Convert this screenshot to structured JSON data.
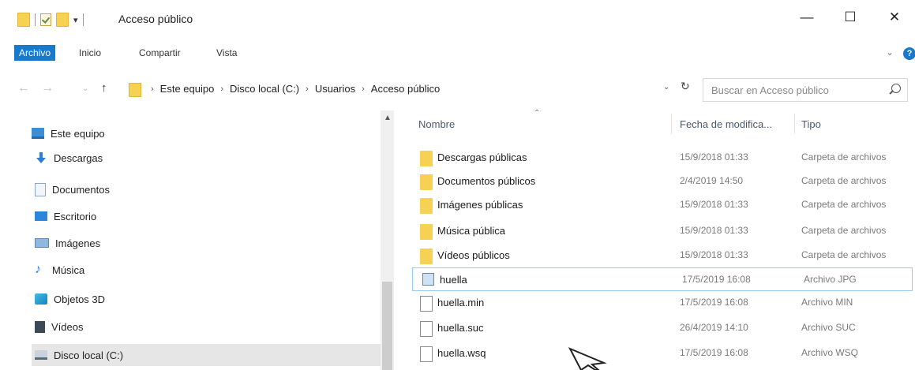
{
  "window": {
    "title": "Acceso público",
    "controls": {
      "minimize": "—",
      "maximize": "☐",
      "close": "✕"
    }
  },
  "ribbon": {
    "tabs": [
      "Archivo",
      "Inicio",
      "Compartir",
      "Vista"
    ],
    "expand": "⌄",
    "help": "?"
  },
  "address_bar": {
    "nav": {
      "back": "←",
      "forward": "→",
      "recent": "⌄",
      "up": "↑"
    },
    "breadcrumb": [
      "Este equipo",
      "Disco local (C:)",
      "Usuarios",
      "Acceso público"
    ],
    "chevron": "›",
    "dropdown": "⌄",
    "refresh": "↻"
  },
  "search": {
    "placeholder": "Buscar en Acceso público"
  },
  "nav_pane": {
    "items": [
      {
        "label": "Este equipo",
        "icon": "computer-icon"
      },
      {
        "label": "Descargas",
        "icon": "downloads-icon"
      },
      {
        "label": "Documentos",
        "icon": "documents-icon"
      },
      {
        "label": "Escritorio",
        "icon": "desktop-icon"
      },
      {
        "label": "Imágenes",
        "icon": "pictures-icon"
      },
      {
        "label": "Música",
        "icon": "music-icon"
      },
      {
        "label": "Objetos 3D",
        "icon": "objects-3d-icon"
      },
      {
        "label": "Vídeos",
        "icon": "videos-icon"
      },
      {
        "label": "Disco local (C:)",
        "icon": "drive-icon"
      }
    ],
    "selected": "Disco local (C:)",
    "music_glyph": "♪",
    "scroll_up": "▲"
  },
  "file_list": {
    "columns": {
      "name": "Nombre",
      "date": "Fecha de modifica...",
      "type": "Tipo"
    },
    "sort_indicator": "⌃",
    "rows": [
      {
        "name": "Descargas públicas",
        "date": "15/9/2018 01:33",
        "type": "Carpeta de archivos",
        "icon": "folder-icon"
      },
      {
        "name": "Documentos públicos",
        "date": "2/4/2019 14:50",
        "type": "Carpeta de archivos",
        "icon": "folder-icon"
      },
      {
        "name": "Imágenes públicas",
        "date": "15/9/2018 01:33",
        "type": "Carpeta de archivos",
        "icon": "folder-icon"
      },
      {
        "name": "Música pública",
        "date": "15/9/2018 01:33",
        "type": "Carpeta de archivos",
        "icon": "folder-icon"
      },
      {
        "name": "Vídeos públicos",
        "date": "15/9/2018 01:33",
        "type": "Carpeta de archivos",
        "icon": "folder-icon"
      },
      {
        "name": "huella",
        "date": "17/5/2019 16:08",
        "type": "Archivo JPG",
        "icon": "image-file-icon"
      },
      {
        "name": "huella.min",
        "date": "17/5/2019 16:08",
        "type": "Archivo MIN",
        "icon": "file-icon"
      },
      {
        "name": "huella.suc",
        "date": "26/4/2019 14:10",
        "type": "Archivo SUC",
        "icon": "file-icon"
      },
      {
        "name": "huella.wsq",
        "date": "17/5/2019 16:08",
        "type": "Archivo WSQ",
        "icon": "file-icon"
      }
    ],
    "selected_row": "huella"
  },
  "colors": {
    "accent": "#1979ca",
    "folder": "#f7d154",
    "selection_border": "#99c9ef",
    "nav_selected_bg": "#e6e6e6"
  }
}
